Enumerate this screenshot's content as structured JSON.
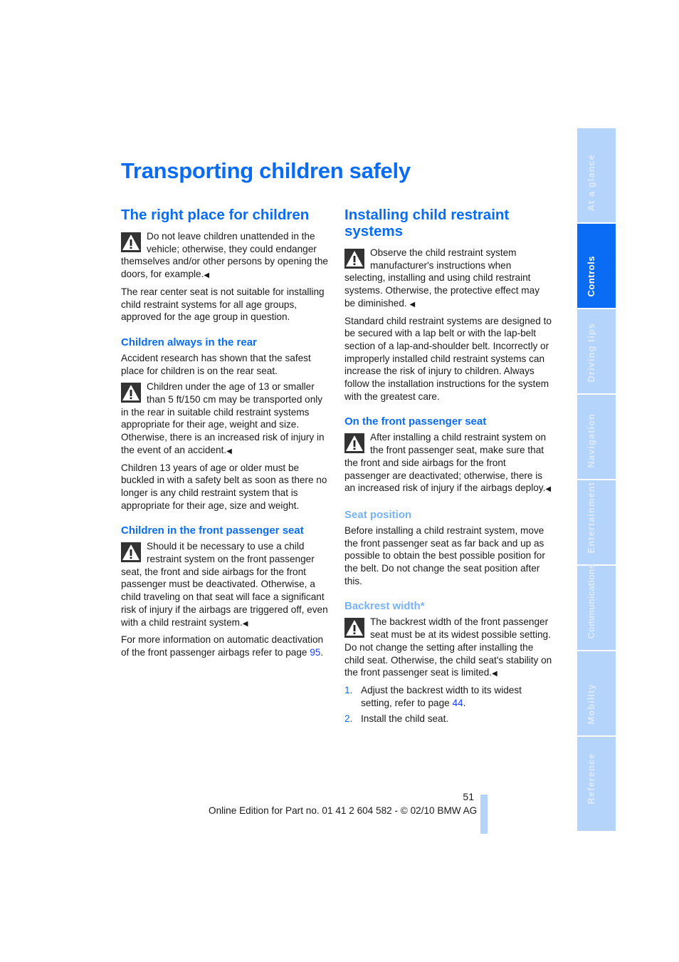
{
  "page_title": "Transporting children safely",
  "left_column": {
    "heading": "The right place for children",
    "warning1": "Do not leave children unattended in the vehicle; otherwise, they could endanger themselves and/or other persons by opening the doors, for example.",
    "para1": "The rear center seat is not suitable for installing child restraint systems for all age groups, approved for the age group in question.",
    "sub1": {
      "heading": "Children always in the rear",
      "para": "Accident research has shown that the safest place for children is on the rear seat.",
      "warning": "Children under the age of 13 or smaller than 5 ft/150 cm may be transported only in the rear in suitable child restraint systems appropriate for their age, weight and size. Otherwise, there is an increased risk of injury in the event of an accident.",
      "para2": "Children 13 years of age or older must be buckled in with a safety belt as soon as there no longer is any child restraint system that is appropriate for their age, size and weight."
    },
    "sub2": {
      "heading": "Children in the front passenger seat",
      "warning": "Should it be necessary to use a child restraint system on the front passenger seat, the front and side airbags for the front passenger must be deactivated. Otherwise, a child traveling on that seat will face a significant risk of injury if the airbags are triggered off, even with a child restraint system.",
      "para_prefix": "For more information on automatic deactivation of the front passenger airbags refer to page ",
      "page_link": "95",
      "para_suffix": "."
    }
  },
  "right_column": {
    "heading": "Installing child restraint systems",
    "warning1": "Observe the child restraint system manufacturer's instructions when selecting, installing and using child restraint systems. Otherwise, the protective effect may be diminished.",
    "para1": "Standard child restraint systems are designed to be secured with a lap belt or with the lap-belt section of a lap-and-shoulder belt. Incorrectly or improperly installed child restraint systems can increase the risk of injury to children. Always follow the installation instructions for the system with the greatest care.",
    "sub1": {
      "heading": "On the front passenger seat",
      "warning": "After installing a child restraint system on the front passenger seat, make sure that the front and side airbags for the front passenger are deactivated; otherwise, there is an increased risk of injury if the airbags deploy."
    },
    "sub2": {
      "heading": "Seat position",
      "para": "Before installing a child restraint system, move the front passenger seat as far back and up as possible to obtain the best possible position for the belt. Do not change the seat position after this."
    },
    "sub3": {
      "heading": "Backrest width*",
      "warning": "The backrest width of the front passenger seat must be at its widest possible setting. Do not change the setting after installing the child seat. Otherwise, the child seat's stability on the front passenger seat is limited.",
      "steps": [
        {
          "num": "1.",
          "text": "Adjust the backrest width to its widest setting, refer to page ",
          "link": "44",
          "suffix": "."
        },
        {
          "num": "2.",
          "text": "Install the child seat.",
          "link": "",
          "suffix": ""
        }
      ]
    }
  },
  "end_mark": "◀",
  "side_tabs": [
    {
      "label": "At a glance",
      "active": false
    },
    {
      "label": "Controls",
      "active": true
    },
    {
      "label": "Driving tips",
      "active": false
    },
    {
      "label": "Navigation",
      "active": false
    },
    {
      "label": "Entertainment",
      "active": false
    },
    {
      "label": "Communications",
      "active": false
    },
    {
      "label": "Mobility",
      "active": false
    },
    {
      "label": "Reference",
      "active": false
    }
  ],
  "footer": {
    "page_number": "51",
    "edition": "Online Edition for Part no. 01 41 2 604 582 - © 02/10 BMW AG"
  },
  "colors": {
    "accent": "#0a6cf5",
    "accent_light": "#78b2f7",
    "tab_inactive": "#b4d4fb",
    "link": "#1a3cff"
  }
}
